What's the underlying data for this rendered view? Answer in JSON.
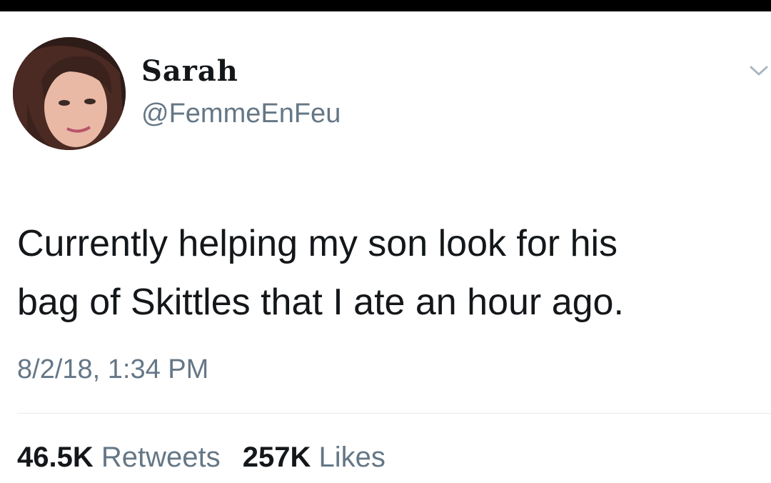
{
  "tweet": {
    "author": {
      "display_name": "Sarah",
      "handle": "@FemmeEnFeu",
      "avatar_icon": "profile-photo"
    },
    "menu_icon": "chevron-down-icon",
    "text_lines": [
      "Currently helping my son look for his",
      "bag of Skittles that I ate an hour ago."
    ],
    "timestamp": "8/2/18, 1:34 PM",
    "stats": {
      "retweets_count": "46.5K",
      "retweets_label": "Retweets",
      "likes_count": "257K",
      "likes_label": "Likes"
    }
  },
  "colors": {
    "text_primary": "#14171a",
    "text_secondary": "#657786",
    "divider": "#e6ecf0",
    "top_bar": "#000000"
  }
}
